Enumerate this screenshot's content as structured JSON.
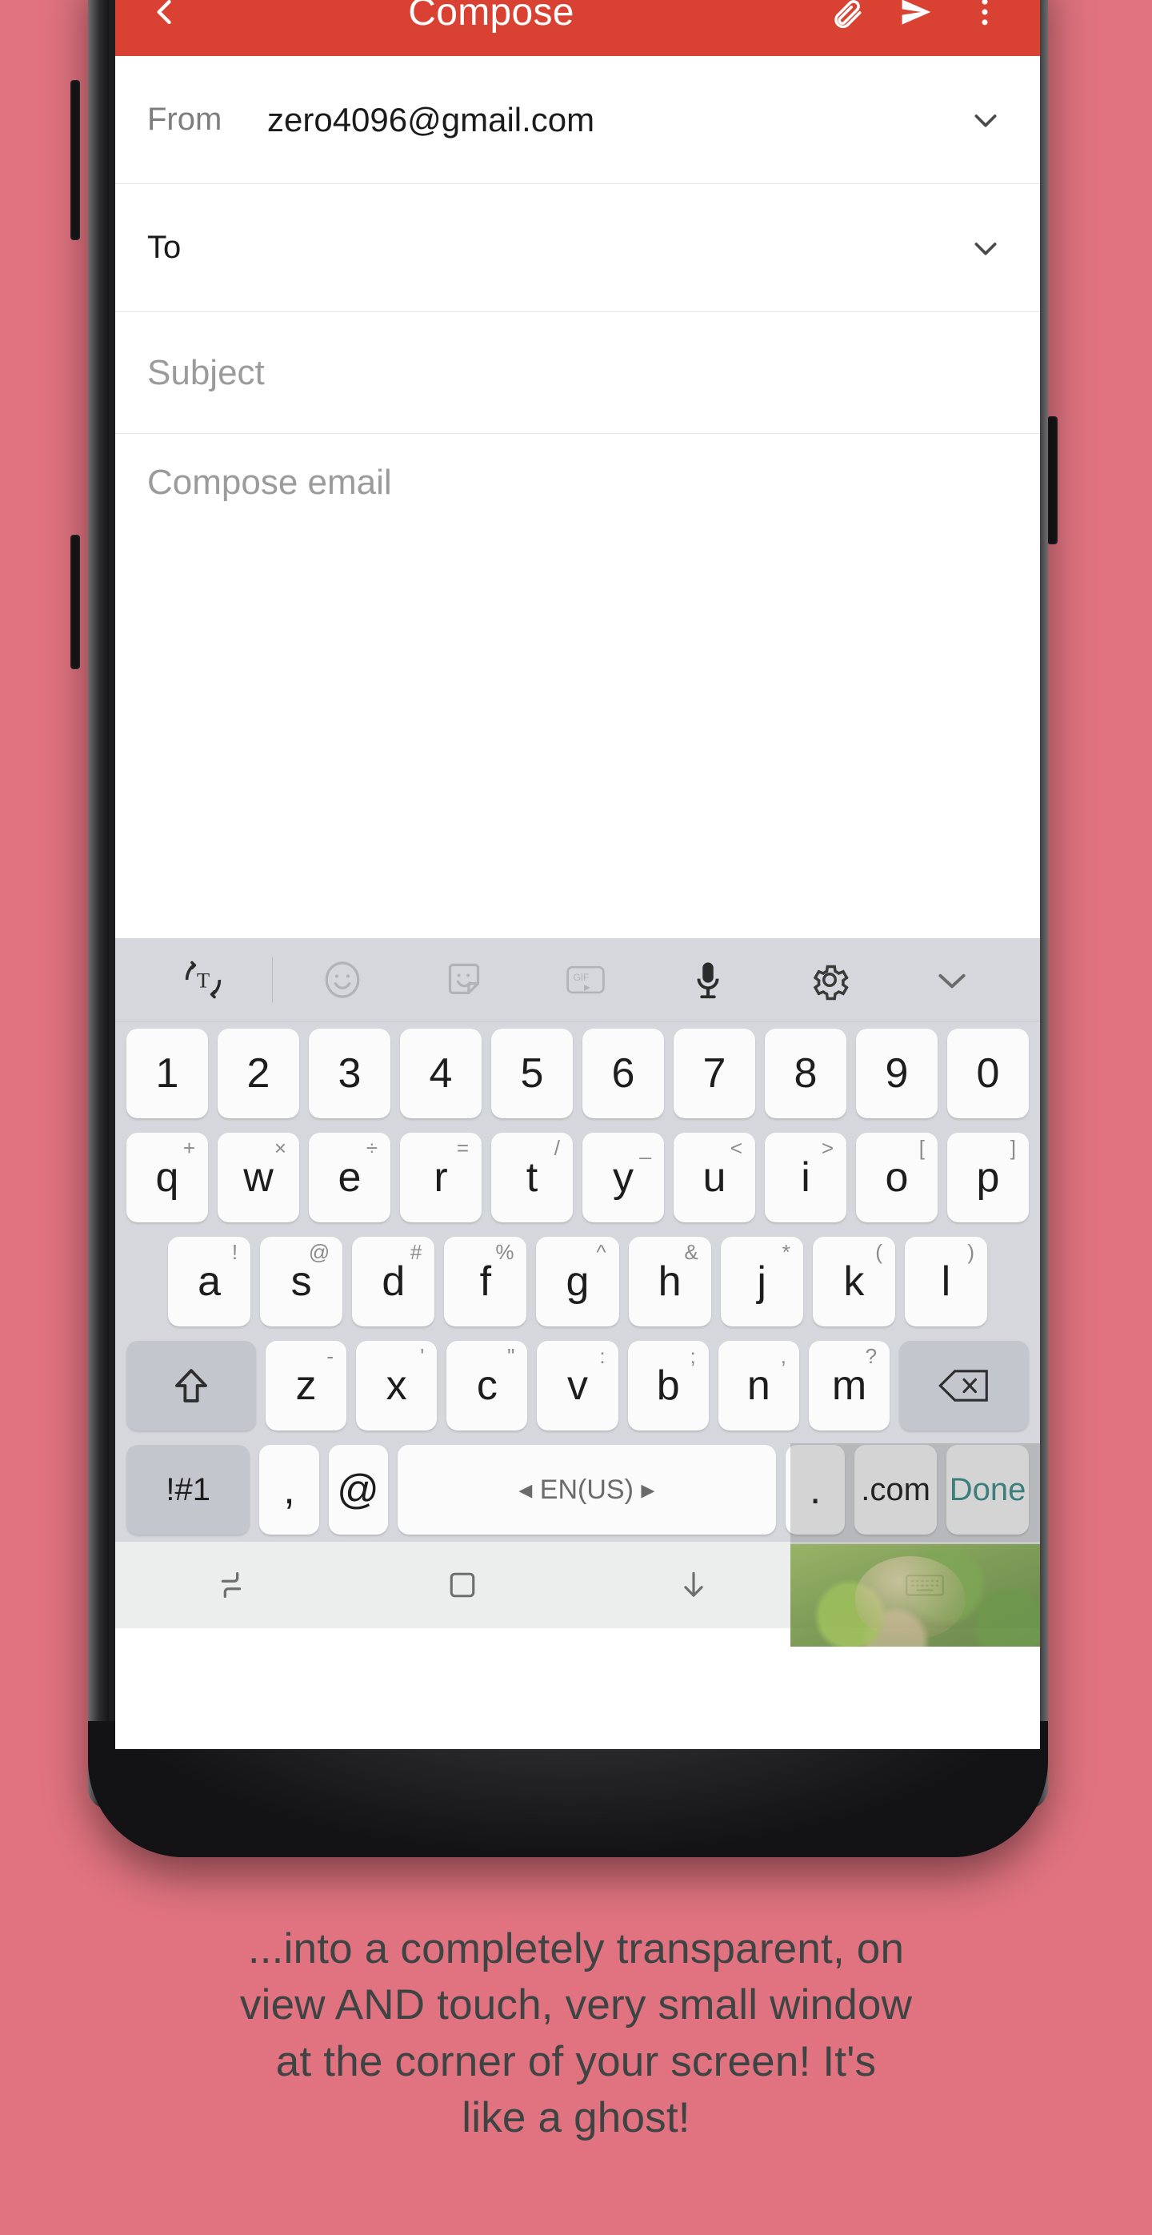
{
  "theme": {
    "background_pink": "#e0737f",
    "gmail_red": "#d94133",
    "keyboard_bg": "#d5d7dc",
    "key_light": "#fbfbfb",
    "key_dark": "#c3c6cc",
    "caption_text": "#3d4443",
    "done_accent": "#3b8f8c"
  },
  "appbar": {
    "back_icon": "chevron-left-icon",
    "title": "Compose",
    "actions": [
      {
        "icon": "attach-file-icon",
        "name": "attach"
      },
      {
        "icon": "send-icon",
        "name": "send"
      },
      {
        "icon": "more-vertical-icon",
        "name": "more-options"
      }
    ]
  },
  "compose": {
    "from": {
      "label": "From",
      "value": "zero4096@gmail.com",
      "chevron": "chevron-down-icon"
    },
    "to": {
      "label": "To",
      "value": "",
      "chevron": "chevron-down-icon"
    },
    "subject": {
      "placeholder": "Subject",
      "value": ""
    },
    "body": {
      "placeholder": "Compose email",
      "value": ""
    }
  },
  "keyboard": {
    "toolbar": [
      {
        "icon": "translate-icon",
        "label": "T"
      },
      {
        "icon": "emoji-icon",
        "label": ""
      },
      {
        "icon": "sticker-icon",
        "label": ""
      },
      {
        "icon": "gif-icon",
        "label": "GIF"
      },
      {
        "icon": "microphone-icon",
        "label": ""
      },
      {
        "icon": "settings-gear-icon",
        "label": ""
      },
      {
        "icon": "chevron-down-icon",
        "label": ""
      }
    ],
    "row_numbers": [
      {
        "key": "1"
      },
      {
        "key": "2"
      },
      {
        "key": "3"
      },
      {
        "key": "4"
      },
      {
        "key": "5"
      },
      {
        "key": "6"
      },
      {
        "key": "7"
      },
      {
        "key": "8"
      },
      {
        "key": "9"
      },
      {
        "key": "0"
      }
    ],
    "row_qwerty": [
      {
        "key": "q",
        "sup": "+"
      },
      {
        "key": "w",
        "sup": "×"
      },
      {
        "key": "e",
        "sup": "÷"
      },
      {
        "key": "r",
        "sup": "="
      },
      {
        "key": "t",
        "sup": "/"
      },
      {
        "key": "y",
        "sup": "_"
      },
      {
        "key": "u",
        "sup": "<"
      },
      {
        "key": "i",
        "sup": ">"
      },
      {
        "key": "o",
        "sup": "["
      },
      {
        "key": "p",
        "sup": "]"
      }
    ],
    "row_asdf": [
      {
        "key": "a",
        "sup": "!"
      },
      {
        "key": "s",
        "sup": "@"
      },
      {
        "key": "d",
        "sup": "#"
      },
      {
        "key": "f",
        "sup": "%"
      },
      {
        "key": "g",
        "sup": "^"
      },
      {
        "key": "h",
        "sup": "&"
      },
      {
        "key": "j",
        "sup": "*"
      },
      {
        "key": "k",
        "sup": "("
      },
      {
        "key": "l",
        "sup": ")"
      }
    ],
    "row_zxcv": {
      "shift": {
        "icon": "shift-arrow-up-icon"
      },
      "keys": [
        {
          "key": "z",
          "sup": "-"
        },
        {
          "key": "x",
          "sup": "'"
        },
        {
          "key": "c",
          "sup": "\""
        },
        {
          "key": "v",
          "sup": ":"
        },
        {
          "key": "b",
          "sup": ";"
        },
        {
          "key": "n",
          "sup": ","
        },
        {
          "key": "m",
          "sup": "?"
        }
      ],
      "backspace": {
        "icon": "backspace-icon"
      }
    },
    "row_bottom": {
      "symbols": "!#1",
      "comma": ",",
      "at": "@",
      "spacebar": "◂ EN(US) ▸",
      "period": ".",
      "dotcom": ".com",
      "done": "Done"
    }
  },
  "navbar": [
    {
      "icon": "recents-icon",
      "name": "recents"
    },
    {
      "icon": "home-square-icon",
      "name": "home"
    },
    {
      "icon": "hide-keyboard-arrow-down-icon",
      "name": "hide-keyboard"
    },
    {
      "icon": "keyboard-switch-icon",
      "name": "keyboard-switch"
    }
  ],
  "caption": {
    "lines": [
      "...into a completely transparent, on",
      "view AND touch, very small window",
      "at the corner of your screen! It's",
      "like a ghost!"
    ]
  }
}
